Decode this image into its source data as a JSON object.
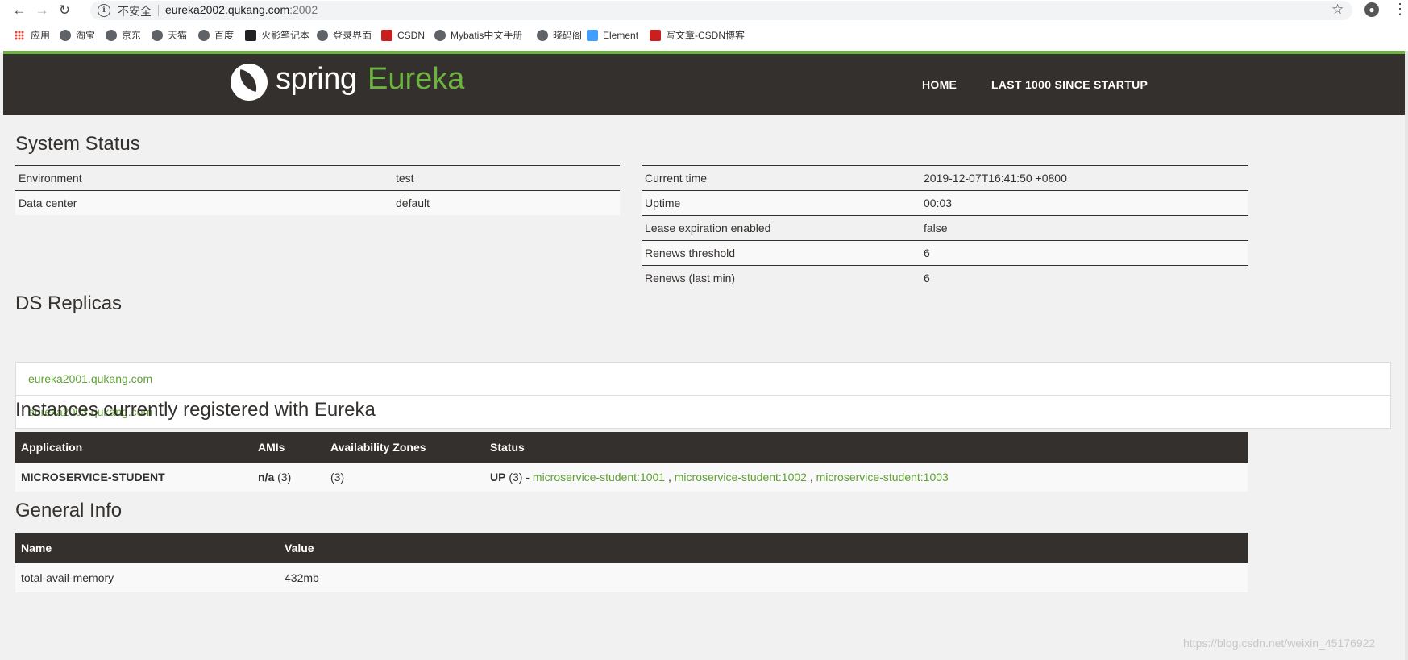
{
  "browser": {
    "not_secure": "不安全",
    "url_host": "eureka2002.qukang.com",
    "url_port": ":2002",
    "bookmarks": [
      {
        "label": "应用",
        "icon": "apps-icon"
      },
      {
        "label": "淘宝",
        "icon": "globe-icon"
      },
      {
        "label": "京东",
        "icon": "globe-icon"
      },
      {
        "label": "天猫",
        "icon": "globe-icon"
      },
      {
        "label": "百度",
        "icon": "globe-icon"
      },
      {
        "label": "火影笔记本",
        "icon": "naruto-icon"
      },
      {
        "label": "登录界面",
        "icon": "globe-icon"
      },
      {
        "label": "CSDN",
        "icon": "csdn-icon"
      },
      {
        "label": "Mybatis中文手册",
        "icon": "globe-icon"
      },
      {
        "label": "晓码阁",
        "icon": "globe-icon"
      },
      {
        "label": "Element",
        "icon": "element-icon"
      },
      {
        "label": "写文章-CSDN博客",
        "icon": "csdn-icon"
      }
    ]
  },
  "header": {
    "logo_spring": "spring",
    "logo_eureka": "Eureka",
    "nav_home": "HOME",
    "nav_last": "LAST 1000 SINCE STARTUP"
  },
  "system_status": {
    "title": "System Status",
    "left": [
      {
        "key": "Environment",
        "value": "test"
      },
      {
        "key": "Data center",
        "value": "default"
      }
    ],
    "right": [
      {
        "key": "Current time",
        "value": "2019-12-07T16:41:50 +0800"
      },
      {
        "key": "Uptime",
        "value": "00:03"
      },
      {
        "key": "Lease expiration enabled",
        "value": "false"
      },
      {
        "key": "Renews threshold",
        "value": "6"
      },
      {
        "key": "Renews (last min)",
        "value": "6"
      }
    ]
  },
  "ds_replicas": {
    "title": "DS Replicas",
    "items": [
      "eureka2001.qukang.com",
      "eureka2003.qukang.com"
    ]
  },
  "instances": {
    "title": "Instances currently registered with Eureka",
    "headers": [
      "Application",
      "AMIs",
      "Availability Zones",
      "Status"
    ],
    "rows": [
      {
        "application": "MICROSERVICE-STUDENT",
        "ami_label": "n/a",
        "ami_count": "(3)",
        "zones": "(3)",
        "status_label": "UP",
        "status_count": "(3) -",
        "links": [
          "microservice-student:1001",
          "microservice-student:1002",
          "microservice-student:1003"
        ]
      }
    ]
  },
  "general_info": {
    "title": "General Info",
    "headers": [
      "Name",
      "Value"
    ],
    "rows": [
      {
        "name": "total-avail-memory",
        "value": "432mb"
      }
    ]
  },
  "watermark": "https://blog.csdn.net/weixin_45176922"
}
